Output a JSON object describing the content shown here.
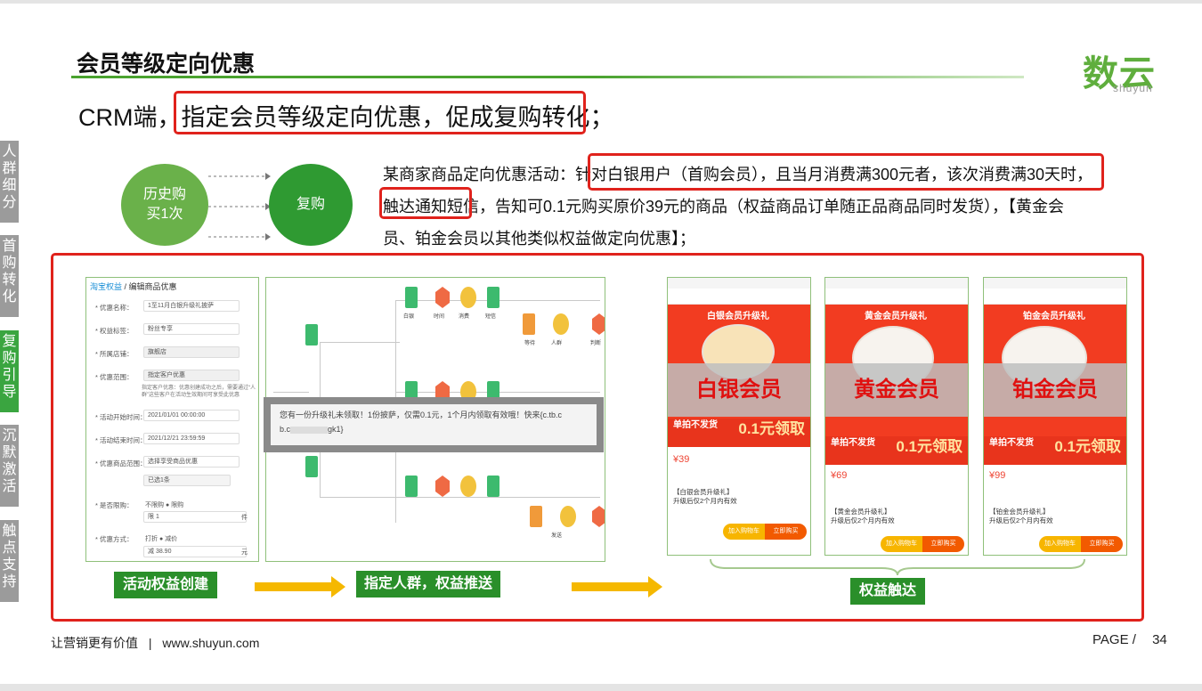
{
  "header": {
    "title": "会员等级定向优惠",
    "logo_main": "数云",
    "logo_sub": "shuyun"
  },
  "intro": {
    "prefix": "CRM端，",
    "highlight": "指定会员等级定向优惠，促成复购转化；"
  },
  "sidebar": {
    "items": [
      {
        "label": "人群细分",
        "active": false
      },
      {
        "label": "首购转化",
        "active": false
      },
      {
        "label": "复购引导",
        "active": true
      },
      {
        "label": "沉默激活",
        "active": false
      },
      {
        "label": "触点支持",
        "active": false
      }
    ]
  },
  "flow_circles": {
    "left": "历史购买1次",
    "right": "复购"
  },
  "description": {
    "part1": "某商家商品定向优惠活动：",
    "part2": "针对白银用户（首购会员），且当月消费满300元者，该次消费",
    "part3": "满30天时，",
    "part4": "触达通知短信，告知可0.1元购买原价39元的商品（权益商品订单随正品商品同时发货），【黄金会员、铂金会员以其他类似权益做定向优惠】；"
  },
  "form_panel": {
    "breadcrumb_link": "淘宝权益",
    "breadcrumb_rest": " / 编辑商品优惠",
    "fields": [
      {
        "label": "* 优惠名称：",
        "value": "1至11月白银升级礼披萨"
      },
      {
        "label": "* 权益标签：",
        "value": "粉丝专享"
      },
      {
        "label": "* 所属店铺：",
        "value": "旗舰店"
      },
      {
        "label": "* 优惠范围：",
        "value": "指定客户优惠"
      },
      {
        "label": "* 活动开始时间：",
        "value": "2021/01/01 00:00:00"
      },
      {
        "label": "* 活动结束时间：",
        "value": "2021/12/21 23:59:59"
      },
      {
        "label": "* 优惠商品范围：",
        "value": "选择享受商品优惠"
      },
      {
        "label": "",
        "value": "已选1条"
      },
      {
        "label": "* 是否限购：",
        "value": "不限购  ● 限购"
      },
      {
        "label": "",
        "value": "限  1"
      },
      {
        "label": "* 优惠方式：",
        "value": "打折  ● 减价"
      },
      {
        "label": "",
        "value": "减  38.90"
      }
    ],
    "hint": "指定客户优惠：优惠创建成功之后，需要通过“人群”这些客户在活动生效期间可享受此优惠",
    "unit1": "件",
    "unit2": "元"
  },
  "flow_panel": {
    "labels": [
      "白银",
      "时间",
      "消费",
      "短信",
      "等待",
      "人群",
      "判断",
      "发送"
    ],
    "sms_text": "您有一份升级礼未领取！1份披萨，仅需0.1元，1个月内领取有效哦！快来{c.tb.c",
    "sms_text2": "gk1}"
  },
  "phones": [
    {
      "tier": "白银会员",
      "banner": "白银会员升级礼",
      "price": "¥39",
      "deal": "单拍不发货",
      "big": "0.1元领取",
      "name": "【白银会员升级礼】",
      "desc": "升级后仅2个月内有效",
      "btn1": "加入购物车",
      "btn2": "立即购买"
    },
    {
      "tier": "黄金会员",
      "banner": "黄金会员升级礼",
      "price": "¥69",
      "deal": "单拍不发货",
      "big": "0.1元领取",
      "name": "【黄金会员升级礼】",
      "desc": "升级后仅2个月内有效",
      "btn1": "加入购物车",
      "btn2": "立即购买"
    },
    {
      "tier": "铂金会员",
      "banner": "铂金会员升级礼",
      "price": "¥99",
      "deal": "单拍不发货",
      "big": "0.1元领取",
      "name": "【铂金会员升级礼】",
      "desc": "升级后仅2个月内有效",
      "btn1": "加入购物车",
      "btn2": "立即购买"
    }
  ],
  "steps": {
    "step1": "活动权益创建",
    "step2": "指定人群，权益推送",
    "step3": "权益触达"
  },
  "footer": {
    "slogan": "让营销更有价值",
    "divider": "|",
    "site": "www.shuyun.com",
    "page_label": "PAGE /",
    "page_num": "34"
  },
  "colors": {
    "accent_green": "#4aa32f",
    "highlight_red": "#e0221c",
    "step_green": "#2a8f2a",
    "arrow_yellow": "#f5b800"
  }
}
